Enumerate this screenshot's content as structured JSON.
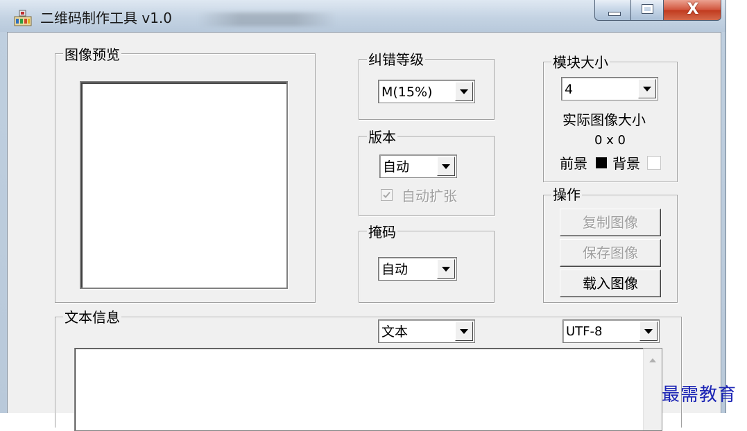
{
  "window": {
    "title": "二维码制作工具 v1.0",
    "close_glyph": "X"
  },
  "preview": {
    "legend": "图像预览"
  },
  "error_correction": {
    "legend": "纠错等级",
    "selected": "M(15%)"
  },
  "version": {
    "legend": "版本",
    "selected": "自动",
    "auto_expand_label": "自动扩张",
    "auto_expand_checked": true,
    "auto_expand_enabled": false
  },
  "mask": {
    "legend": "掩码",
    "selected": "自动"
  },
  "module_size": {
    "legend": "模块大小",
    "selected": "4",
    "actual_size_label": "实际图像大小",
    "actual_size_value": "0 x 0",
    "foreground_label": "前景",
    "background_label": "背景",
    "foreground_color": "#000000",
    "background_color": "#ffffff"
  },
  "operations": {
    "legend": "操作",
    "copy_label": "复制图像",
    "save_label": "保存图像",
    "load_label": "载入图像"
  },
  "text_info": {
    "legend": "文本信息",
    "type_selected": "文本",
    "encoding_selected": "UTF-8",
    "content": ""
  },
  "watermark": "最需教育"
}
